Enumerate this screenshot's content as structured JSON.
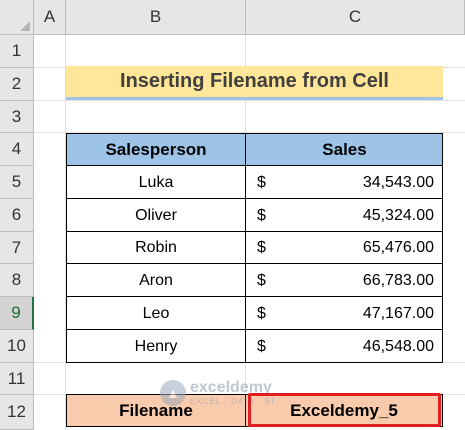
{
  "sheet": {
    "columns": [
      "A",
      "B",
      "C"
    ],
    "rows": [
      "1",
      "2",
      "3",
      "4",
      "5",
      "6",
      "7",
      "8",
      "9",
      "10",
      "11",
      "12"
    ],
    "selected_row": "9"
  },
  "title": "Inserting Filename from Cell",
  "table": {
    "headers": [
      "Salesperson",
      "Sales"
    ],
    "rows": [
      {
        "name": "Luka",
        "currency": "$",
        "amount": "34,543.00"
      },
      {
        "name": "Oliver",
        "currency": "$",
        "amount": "45,324.00"
      },
      {
        "name": "Robin",
        "currency": "$",
        "amount": "65,476.00"
      },
      {
        "name": "Aron",
        "currency": "$",
        "amount": "66,783.00"
      },
      {
        "name": "Leo",
        "currency": "$",
        "amount": "47,167.00"
      },
      {
        "name": "Henry",
        "currency": "$",
        "amount": "46,548.00"
      }
    ]
  },
  "filename": {
    "label": "Filename",
    "value": "Exceldemy_5"
  },
  "watermark": {
    "name": "exceldemy",
    "tagline": "EXCEL · DATA · BI"
  },
  "colors": {
    "title_fill": "#ffe699",
    "header_fill": "#9dc3e6",
    "filename_fill": "#f8cbad",
    "highlight": "#e02020"
  }
}
